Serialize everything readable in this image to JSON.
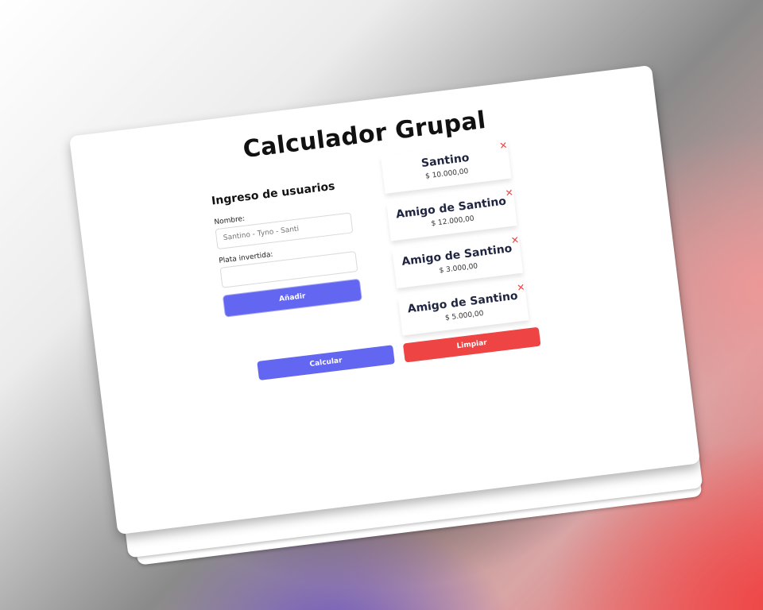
{
  "app": {
    "title": "Calculador Grupal"
  },
  "form": {
    "heading": "Ingreso de usuarios",
    "name_label": "Nombre:",
    "name_placeholder": "Santino - Tyno - Santi",
    "name_value": "",
    "money_label": "Plata invertida:",
    "money_placeholder": "",
    "money_value": "",
    "add_button": "Añadir"
  },
  "users": [
    {
      "name": "Santino",
      "amount": "$ 10.000,00"
    },
    {
      "name": "Amigo de Santino",
      "amount": "$ 12.000,00"
    },
    {
      "name": "Amigo de Santino",
      "amount": "$ 3.000,00"
    },
    {
      "name": "Amigo de Santino",
      "amount": "$ 5.000,00"
    }
  ],
  "remove_symbol": "✕",
  "actions": {
    "calculate": "Calcular",
    "clear": "Limpiar"
  },
  "colors": {
    "primary": "#6366f1",
    "danger": "#ef4444",
    "text_dark": "#1f2540"
  }
}
